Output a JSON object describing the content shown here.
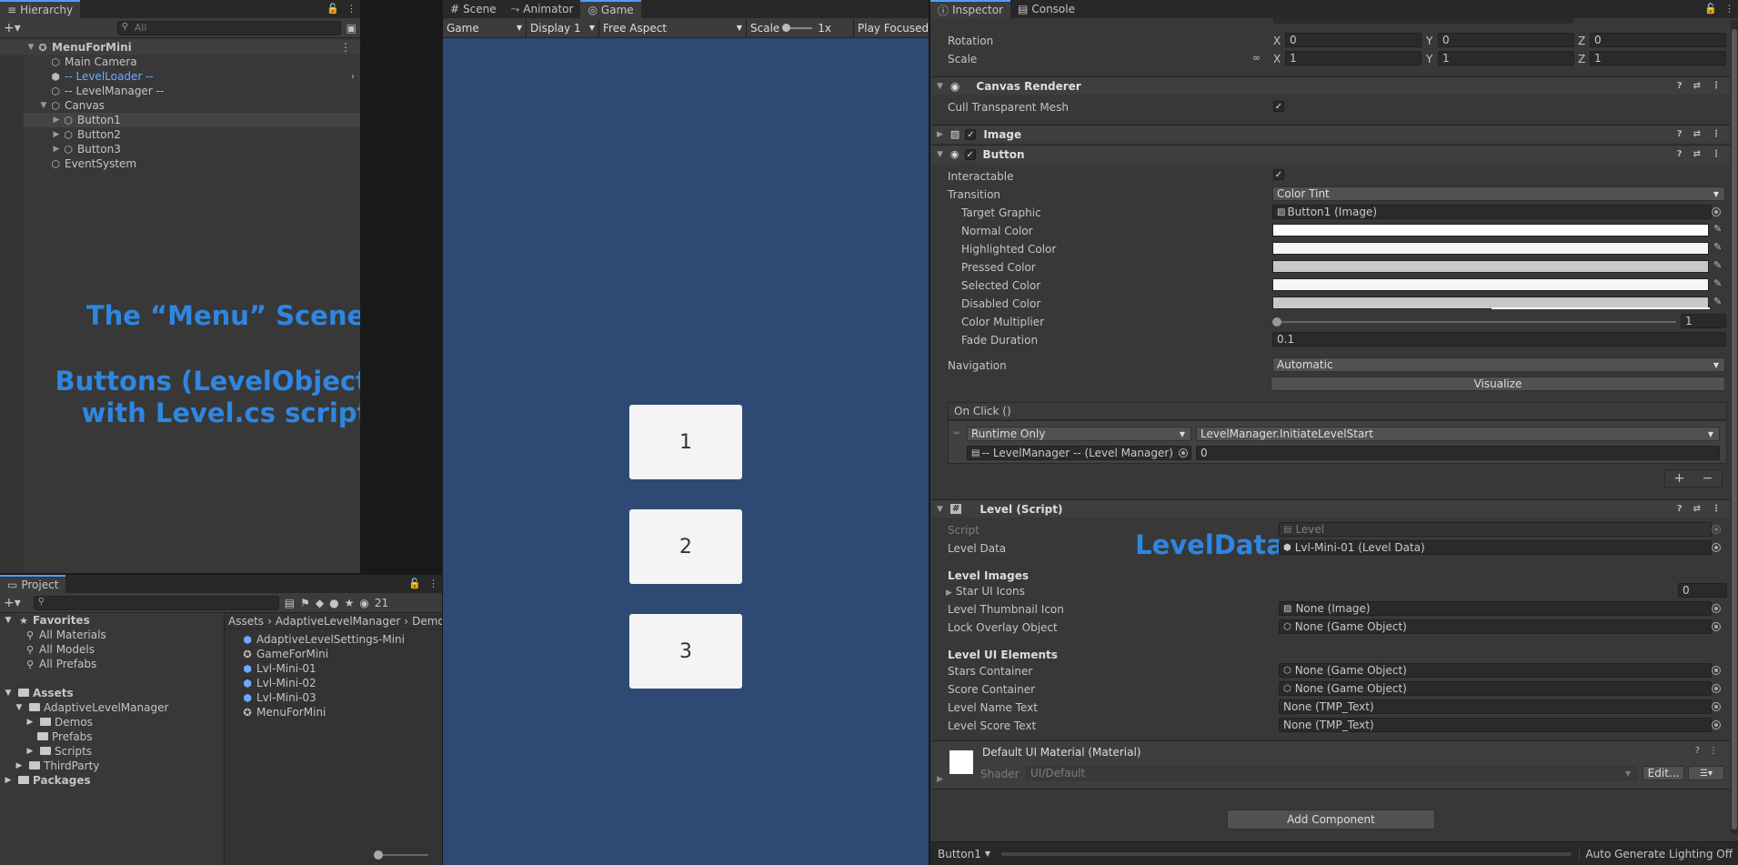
{
  "hierarchy": {
    "tab": "Hierarchy",
    "search_placeholder": "All",
    "scene": "MenuForMini",
    "items": [
      "Main Camera",
      "-- LevelLoader --",
      "-- LevelManager --",
      "Canvas",
      "Button1",
      "Button2",
      "Button3",
      "EventSystem"
    ]
  },
  "annotations": {
    "menu_scene": "The “Menu” Scene",
    "buttons_line1": "Buttons (LevelObjects)",
    "buttons_line2": "with Level.cs script",
    "level_data": "LevelData"
  },
  "project": {
    "tab": "Project",
    "count": "21",
    "favorites_label": "Favorites",
    "favorites": [
      "All Materials",
      "All Models",
      "All Prefabs"
    ],
    "assets_label": "Assets",
    "folders": [
      "AdaptiveLevelManager",
      "Demos",
      "Prefabs",
      "Scripts",
      "ThirdParty"
    ],
    "packages": "Packages",
    "breadcrumb": [
      "Assets",
      "AdaptiveLevelManager",
      "Demo"
    ],
    "files": [
      "AdaptiveLevelSettings-Mini",
      "GameForMini",
      "Lvl-Mini-01",
      "Lvl-Mini-02",
      "Lvl-Mini-03",
      "MenuForMini"
    ]
  },
  "center": {
    "tabs": [
      "Scene",
      "Animator",
      "Game"
    ],
    "toolbar": {
      "mode": "Game",
      "display": "Display 1",
      "aspect": "Free Aspect",
      "scale_label": "Scale",
      "scale_value": "1x",
      "play": "Play Focused"
    },
    "buttons": [
      "1",
      "2",
      "3"
    ],
    "bg": "#2e4a74"
  },
  "inspector": {
    "tabs": [
      "Inspector",
      "Console"
    ],
    "transform": {
      "rotation_label": "Rotation",
      "scale_label": "Scale",
      "rotation": [
        "0",
        "0",
        "0"
      ],
      "scale": [
        "1",
        "1",
        "1"
      ],
      "axes": [
        "X",
        "Y",
        "Z"
      ]
    },
    "canvas_renderer": {
      "title": "Canvas Renderer",
      "cull_label": "Cull Transparent Mesh"
    },
    "image": {
      "title": "Image"
    },
    "button": {
      "title": "Button",
      "interactable": "Interactable",
      "transition_label": "Transition",
      "transition_value": "Color Tint",
      "target_graphic_label": "Target Graphic",
      "target_graphic_value": "Button1 (Image)",
      "normal": "Normal Color",
      "highlighted": "Highlighted Color",
      "pressed": "Pressed Color",
      "selected": "Selected Color",
      "disabled": "Disabled Color",
      "multiplier_label": "Color Multiplier",
      "multiplier_value": "1",
      "fade_label": "Fade Duration",
      "fade_value": "0.1",
      "navigation_label": "Navigation",
      "navigation_value": "Automatic",
      "visualize": "Visualize",
      "onclick": "On Click ()",
      "runtime": "Runtime Only",
      "function": "LevelManager.InitiateLevelStart",
      "object": "-- LevelManager -- (Level Manager)",
      "arg": "0"
    },
    "level": {
      "title": "Level (Script)",
      "script_label": "Script",
      "script_value": "Level",
      "level_data_label": "Level Data",
      "level_data_value": "Lvl-Mini-01 (Level Data)",
      "images_title": "Level Images",
      "star_icons": "Star UI Icons",
      "star_count": "0",
      "thumb_label": "Level Thumbnail Icon",
      "thumb_value": "None (Image)",
      "lock_label": "Lock Overlay Object",
      "lock_value": "None (Game Object)",
      "ui_title": "Level UI Elements",
      "stars_label": "Stars Container",
      "stars_value": "None (Game Object)",
      "score_label": "Score Container",
      "score_value": "None (Game Object)",
      "name_label": "Level Name Text",
      "name_value": "None (TMP_Text)",
      "score_text_label": "Level Score Text",
      "score_text_value": "None (TMP_Text)"
    },
    "material": {
      "title": "Default UI Material (Material)",
      "shader_label": "Shader",
      "shader_value": "UI/Default",
      "edit": "Edit..."
    },
    "add_component": "Add Component"
  },
  "status": {
    "object": "Button1",
    "lighting": "Auto Generate Lighting Off"
  }
}
